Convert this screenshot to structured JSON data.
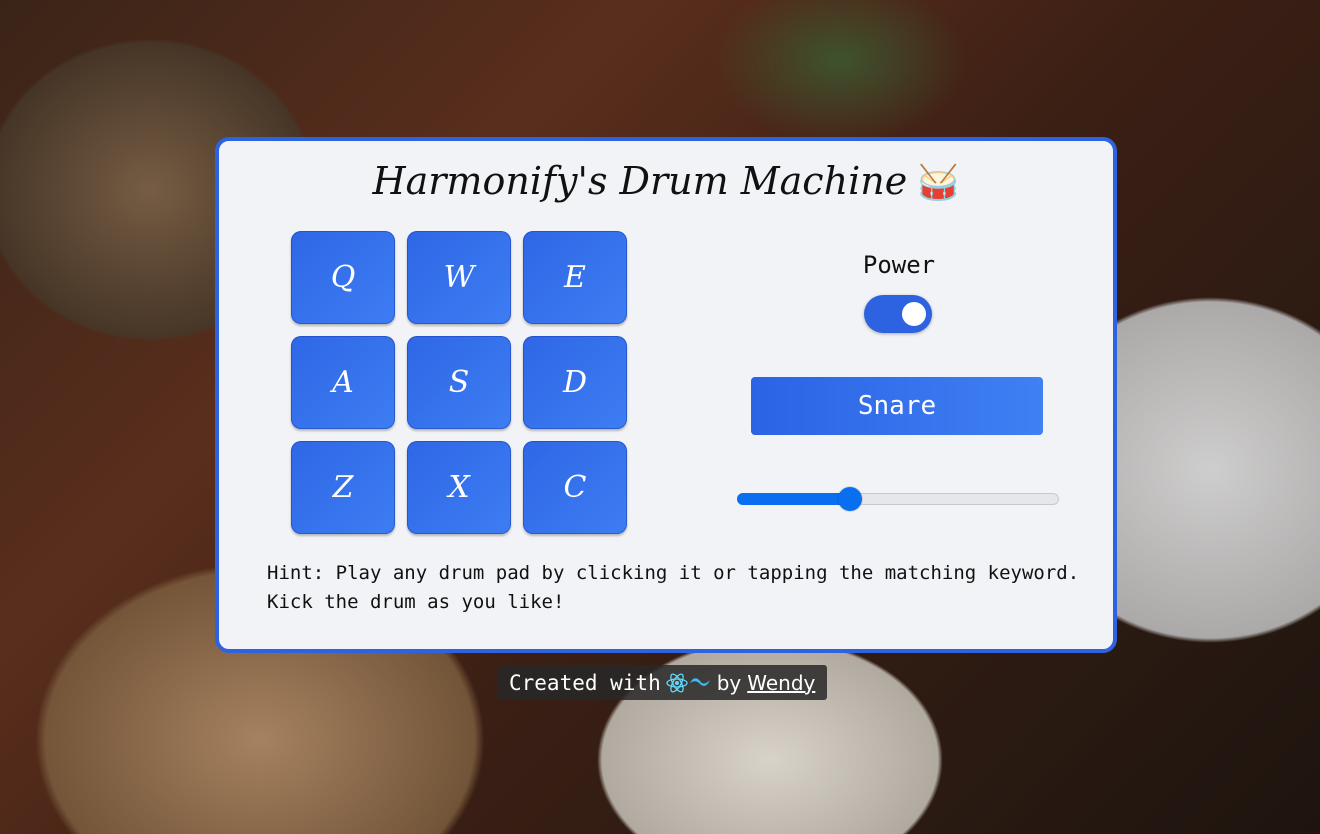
{
  "app": {
    "title": "Harmonify's Drum Machine",
    "title_emoji": "🥁"
  },
  "pads": [
    {
      "key": "Q"
    },
    {
      "key": "W"
    },
    {
      "key": "E"
    },
    {
      "key": "A"
    },
    {
      "key": "S"
    },
    {
      "key": "D"
    },
    {
      "key": "Z"
    },
    {
      "key": "X"
    },
    {
      "key": "C"
    }
  ],
  "controls": {
    "power_label": "Power",
    "power_on": true,
    "display_text": "Snare",
    "volume": 0.35
  },
  "hint": "Hint: Play any drum pad by clicking it or tapping the matching keyword.\nKick the drum as you like!",
  "footer": {
    "created_with": "Created with",
    "icons": [
      "react-icon",
      "tailwind-icon"
    ],
    "by": "by",
    "author": "Wendy"
  },
  "colors": {
    "accent": "#2d63e0",
    "slider": "#0a6ef0",
    "card_bg": "#f2f3f6"
  }
}
